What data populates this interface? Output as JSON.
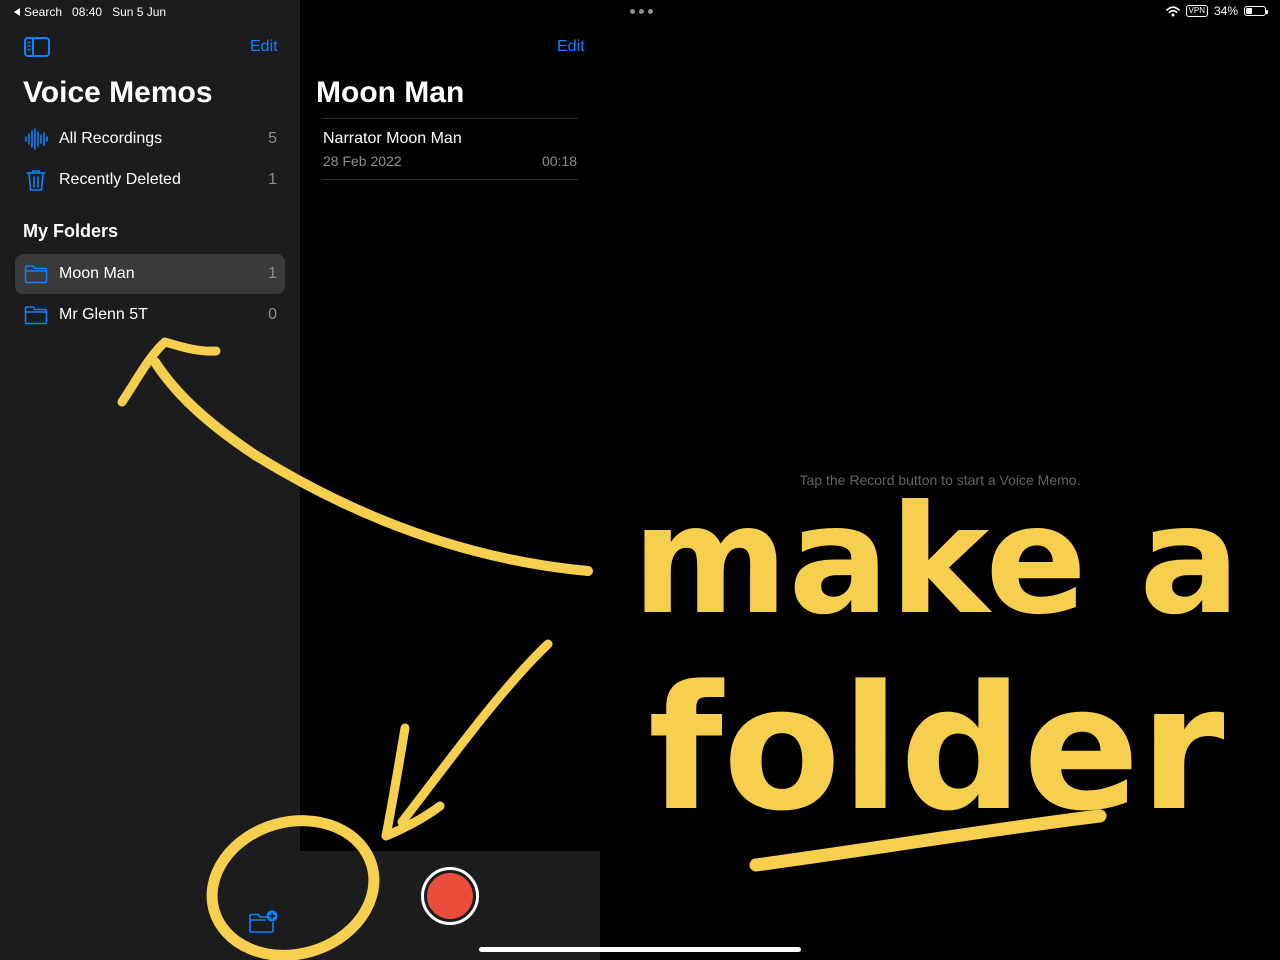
{
  "status_bar": {
    "back_label": "Search",
    "time": "08:40",
    "date": "Sun 5 Jun",
    "vpn": "VPN",
    "battery": "34%",
    "battery_level": 0.34
  },
  "sidebar": {
    "edit_label": "Edit",
    "title": "Voice Memos",
    "items": [
      {
        "label": "All Recordings",
        "count": "5"
      },
      {
        "label": "Recently Deleted",
        "count": "1"
      }
    ],
    "folders_heading": "My Folders",
    "folders": [
      {
        "label": "Moon Man",
        "count": "1"
      },
      {
        "label": "Mr Glenn 5T",
        "count": "0"
      }
    ]
  },
  "list": {
    "edit_label": "Edit",
    "title": "Moon Man",
    "recordings": [
      {
        "title": "Narrator Moon Man",
        "date": "28 Feb 2022",
        "duration": "00:18"
      }
    ]
  },
  "detail": {
    "empty_hint": "Tap the Record button to start a Voice Memo."
  },
  "annotation": {
    "line1": "make a",
    "line2": "folder",
    "color": "#f7cf4f"
  },
  "colors": {
    "accent": "#0a84ff",
    "record": "#eb4d3d",
    "sidebar_bg": "#1c1c1e"
  }
}
